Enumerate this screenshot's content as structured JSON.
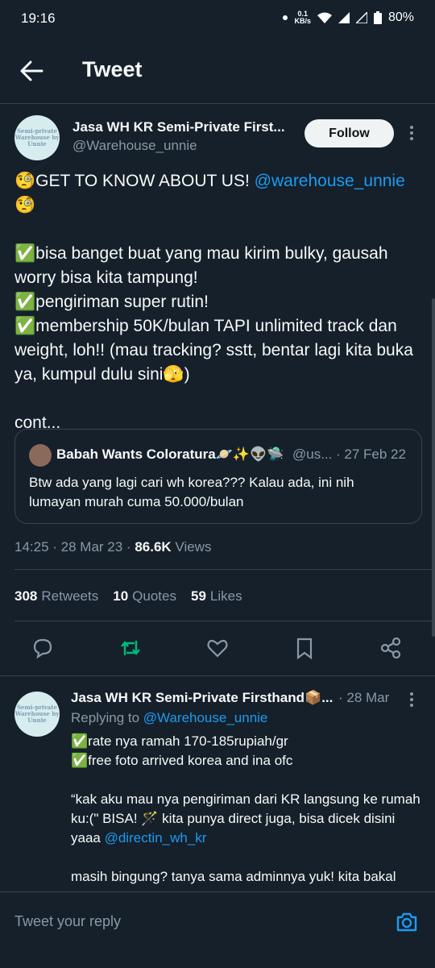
{
  "status_bar": {
    "time": "19:16",
    "speed_value": "0.1",
    "speed_unit": "KB/s",
    "battery": "80%"
  },
  "header": {
    "title": "Tweet"
  },
  "tweet": {
    "author_name": "Jasa WH KR Semi-Private First...",
    "author_handle": "@Warehouse_unnie",
    "avatar_text": "Semi-private Warehouse by Unnie",
    "follow_label": "Follow",
    "text_line1": "🧐GET TO KNOW ABOUT US! ",
    "mention1": "@warehouse_unnie",
    "text_line1b": "\n🧐\n\n✅bisa banget buat yang mau kirim bulky, gausah worry bisa kita tampung!\n✅pengiriman super rutin!\n✅membership 50K/bulan TAPI unlimited track dan weight, loh!! (mau tracking? sstt, bentar lagi kita buka ya, kumpul dulu sini🫣)\n\ncont...",
    "quote": {
      "name": "Babah Wants Coloratura🪐✨👽🛸",
      "handle": "@us...",
      "date": "· 27 Feb 22",
      "text": "Btw ada yang lagi cari wh korea??? Kalau ada, ini nih lumayan murah cuma 50.000/bulan"
    },
    "time": "14:25 · 28 Mar 23 · ",
    "views_count": "86.6K",
    "views_label": " Views",
    "retweets_count": "308",
    "retweets_label": "Retweets",
    "quotes_count": "10",
    "quotes_label": "Quotes",
    "likes_count": "59",
    "likes_label": "Likes"
  },
  "reply": {
    "author_name": "Jasa WH KR Semi-Private Firsthand📦...",
    "date": "· 28 Mar",
    "replying_prefix": "Replying to ",
    "replying_handle": "@Warehouse_unnie",
    "text_a": "✅rate nya ramah 170-185rupiah/gr\n✅free foto arrived korea and ina ofc\n\n“kak aku mau nya pengiriman dari KR langsung ke rumah ku:(\" BISA! 🪄 kita punya direct juga, bisa dicek disini yaaa ",
    "mention": "@directin_wh_kr",
    "text_b": "\n\nmasih bingung? tanya sama adminnya yuk! kita bakal"
  },
  "compose": {
    "placeholder": "Tweet your reply"
  },
  "colors": {
    "accent": "#1d9bf0",
    "retweet_green": "#00ba7c",
    "background": "#15202b"
  }
}
